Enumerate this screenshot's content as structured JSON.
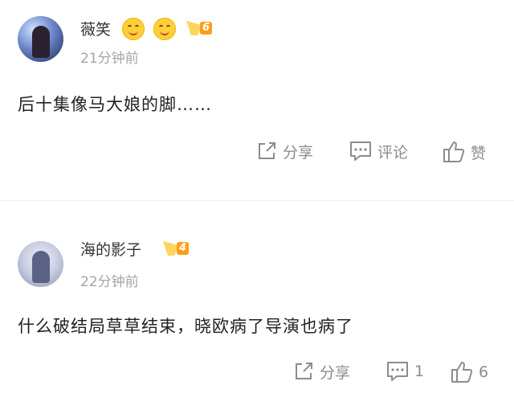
{
  "comments": [
    {
      "username": "薇笑",
      "emojis": [
        "smiling-face-icon",
        "smiling-face-icon"
      ],
      "level": "6",
      "time": "21分钟前",
      "content": "后十集像马大娘的脚……",
      "share_label": "分享",
      "comment_label": "评论",
      "like_label": "赞"
    },
    {
      "username": "海的影子",
      "level": "4",
      "time": "22分钟前",
      "content": "什么破结局草草结束，晓欧病了导演也病了",
      "share_label": "分享",
      "comment_count": "1",
      "like_count": "6"
    }
  ],
  "colors": {
    "text_primary": "#222222",
    "text_secondary": "#a5a5a5",
    "action_gray": "#8c8c8c",
    "badge_orange": "#ff9d1a"
  }
}
